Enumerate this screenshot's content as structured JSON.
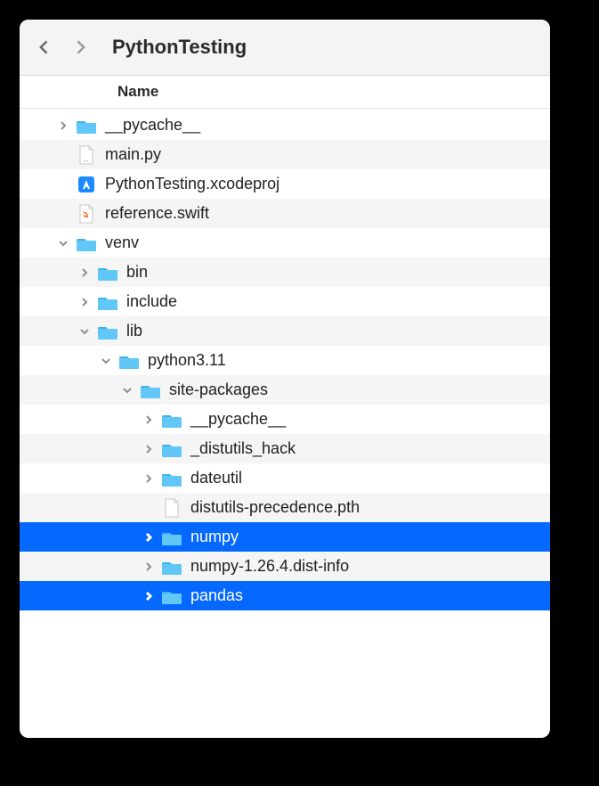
{
  "toolbar": {
    "title": "PythonTesting"
  },
  "columnHeader": "Name",
  "icons": {
    "folder": "folder-icon",
    "pyfile": "python-file-icon",
    "xcodeproj": "xcode-project-icon",
    "swiftfile": "swift-file-icon",
    "genericfile": "generic-file-icon"
  },
  "rows": [
    {
      "depth": 1,
      "disclosure": "closed",
      "icon": "folder",
      "label": "__pycache__",
      "striped": false,
      "selected": false
    },
    {
      "depth": 1,
      "disclosure": "none",
      "icon": "pyfile",
      "label": "main.py",
      "striped": true,
      "selected": false
    },
    {
      "depth": 1,
      "disclosure": "none",
      "icon": "xcodeproj",
      "label": "PythonTesting.xcodeproj",
      "striped": false,
      "selected": false
    },
    {
      "depth": 1,
      "disclosure": "none",
      "icon": "swiftfile",
      "label": "reference.swift",
      "striped": true,
      "selected": false
    },
    {
      "depth": 1,
      "disclosure": "open",
      "icon": "folder",
      "label": "venv",
      "striped": false,
      "selected": false
    },
    {
      "depth": 2,
      "disclosure": "closed",
      "icon": "folder",
      "label": "bin",
      "striped": true,
      "selected": false
    },
    {
      "depth": 2,
      "disclosure": "closed",
      "icon": "folder",
      "label": "include",
      "striped": false,
      "selected": false
    },
    {
      "depth": 2,
      "disclosure": "open",
      "icon": "folder",
      "label": "lib",
      "striped": true,
      "selected": false
    },
    {
      "depth": 3,
      "disclosure": "open",
      "icon": "folder",
      "label": "python3.11",
      "striped": false,
      "selected": false
    },
    {
      "depth": 4,
      "disclosure": "open",
      "icon": "folder",
      "label": "site-packages",
      "striped": true,
      "selected": false
    },
    {
      "depth": 5,
      "disclosure": "closed",
      "icon": "folder",
      "label": "__pycache__",
      "striped": false,
      "selected": false
    },
    {
      "depth": 5,
      "disclosure": "closed",
      "icon": "folder",
      "label": "_distutils_hack",
      "striped": true,
      "selected": false
    },
    {
      "depth": 5,
      "disclosure": "closed",
      "icon": "folder",
      "label": "dateutil",
      "striped": false,
      "selected": false
    },
    {
      "depth": 5,
      "disclosure": "none",
      "icon": "genericfile",
      "label": "distutils-precedence.pth",
      "striped": true,
      "selected": false
    },
    {
      "depth": 5,
      "disclosure": "closed",
      "icon": "folder",
      "label": "numpy",
      "striped": false,
      "selected": true
    },
    {
      "depth": 5,
      "disclosure": "closed",
      "icon": "folder",
      "label": "numpy-1.26.4.dist-info",
      "striped": true,
      "selected": false
    },
    {
      "depth": 5,
      "disclosure": "closed",
      "icon": "folder",
      "label": "pandas",
      "striped": false,
      "selected": true
    }
  ]
}
